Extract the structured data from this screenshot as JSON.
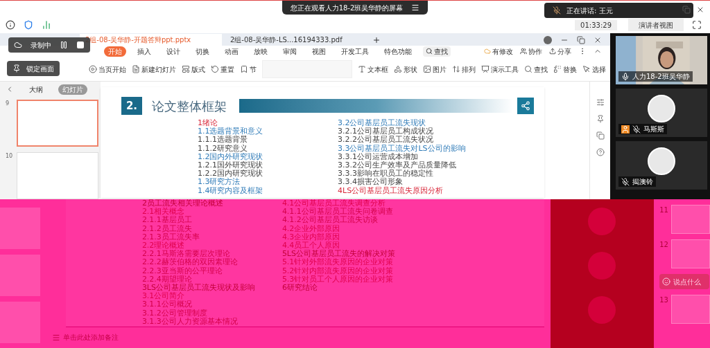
{
  "screen_share_banner": {
    "text": "您正在观看人力18-2班吴华静的屏幕"
  },
  "speaking_toast": {
    "text": "正在讲话: 王元"
  },
  "meeting_bar": {
    "timer": "01:33:29",
    "view_button": "演讲者视图"
  },
  "recording": {
    "status": "录制中",
    "lock_button": "锁定画面"
  },
  "tabs": [
    {
      "label": "2组-08-吴华静-开题答辩ppt.pptx",
      "selected": true
    },
    {
      "label": "2组-08-吴华静-LS...16194333.pdf",
      "selected": false
    }
  ],
  "ribbon_tabs": [
    {
      "label": "开始",
      "selected": true
    },
    {
      "label": "插入",
      "selected": false
    },
    {
      "label": "设计",
      "selected": false
    },
    {
      "label": "切换",
      "selected": false
    },
    {
      "label": "动画",
      "selected": false
    },
    {
      "label": "放映",
      "selected": false
    },
    {
      "label": "审阅",
      "selected": false
    },
    {
      "label": "视图",
      "selected": false
    },
    {
      "label": "开发工具",
      "selected": false
    },
    {
      "label": "特色功能",
      "selected": false
    }
  ],
  "ribbon_search": "查找",
  "ribbon_actions": [
    "有修改",
    "协作",
    "分享"
  ],
  "toolbar": [
    "当页开始",
    "新建幻灯片",
    "版式",
    "重置",
    "节",
    "文本框",
    "形状",
    "图片",
    "排列",
    "演示工具",
    "查找",
    "替换",
    "选择"
  ],
  "pane_tabs": [
    {
      "label": "大纲",
      "selected": false
    },
    {
      "label": "幻灯片",
      "selected": true
    }
  ],
  "thumbnails": [
    {
      "number": "9",
      "selected": true
    },
    {
      "number": "10",
      "selected": false
    }
  ],
  "slide": {
    "number": "2.",
    "title": "论文整体框架",
    "upper_left": [
      {
        "text": "1绪论",
        "kind": "h1"
      },
      {
        "text": "1.1选题背景和意义",
        "kind": "h2"
      },
      {
        "text": "1.1.1选题背景",
        "kind": "h3"
      },
      {
        "text": "1.1.2研究意义",
        "kind": "h3"
      },
      {
        "text": "1.2国内外研究现状",
        "kind": "h2"
      },
      {
        "text": "1.2.1国外研究现状",
        "kind": "h3"
      },
      {
        "text": "1.2.2国内研究现状",
        "kind": "h3"
      },
      {
        "text": "1.3研究方法",
        "kind": "h2"
      },
      {
        "text": "1.4研究内容及框架",
        "kind": "h2"
      }
    ],
    "upper_right": [
      {
        "text": "3.2公司基层员工流失现状",
        "kind": "h2"
      },
      {
        "text": "3.2.1公司基层员工构成状况",
        "kind": "h3"
      },
      {
        "text": "3.2.2公司基层员工流失状况",
        "kind": "h3"
      },
      {
        "text": "3.3公司基层员工流失对LS公司的影响",
        "kind": "h2"
      },
      {
        "text": "3.3.1公司运营成本增加",
        "kind": "h3"
      },
      {
        "text": "3.3.2公司生产效率及产品质量降低",
        "kind": "h3"
      },
      {
        "text": "3.3.3影响在职员工的稳定性",
        "kind": "h3"
      },
      {
        "text": "3.3.4损害公司形象",
        "kind": "h3"
      },
      {
        "text": "4LS公司基层员工流失原因分析",
        "kind": "h1"
      }
    ],
    "lower_left": [
      {
        "text": "2员工流失相关理论概述",
        "kind": "h1"
      },
      {
        "text": "2.1相关概念",
        "kind": "h2"
      },
      {
        "text": "2.1.1基层员工",
        "kind": "h3"
      },
      {
        "text": "2.1.2员工流失",
        "kind": "h3"
      },
      {
        "text": "2.1.3员工流失率",
        "kind": "h3"
      },
      {
        "text": "2.2理论概述",
        "kind": "h2"
      },
      {
        "text": "2.2.1马斯洛需要层次理论",
        "kind": "h3"
      },
      {
        "text": "2.2.2赫茨伯格的双因素理论",
        "kind": "h3"
      },
      {
        "text": "2.2.3亚当斯的公平理论",
        "kind": "h3"
      },
      {
        "text": "2.2.4期望理论",
        "kind": "h3"
      },
      {
        "text": "3LS公司基层员工流失现状及影响",
        "kind": "h1"
      },
      {
        "text": "3.1公司简介",
        "kind": "h2"
      },
      {
        "text": "3.1.1公司概况",
        "kind": "h3"
      },
      {
        "text": "3.1.2公司管理制度",
        "kind": "h3"
      },
      {
        "text": "3.1.3公司人力资源基本情况",
        "kind": "h3"
      }
    ],
    "lower_right": [
      {
        "text": "4.1公司基层员工流失调查分析",
        "kind": "h2"
      },
      {
        "text": "4.1.1公司基层员工流失问卷调查",
        "kind": "h3"
      },
      {
        "text": "4.1.2公司基层员工流失访谈",
        "kind": "h3"
      },
      {
        "text": "4.2企业外部原因",
        "kind": "h2"
      },
      {
        "text": "4.3企业内部原因",
        "kind": "h2"
      },
      {
        "text": "4.4员工个人原因",
        "kind": "h2"
      },
      {
        "text": "5LS公司基层员工流失的解决对策",
        "kind": "h1"
      },
      {
        "text": "5.1针对外部流失原因的企业对策",
        "kind": "h2"
      },
      {
        "text": "5.2针对内部流失原因的企业对策",
        "kind": "h2"
      },
      {
        "text": "5.3针对员工个人原因的企业对策",
        "kind": "h2"
      },
      {
        "text": "6研究结论",
        "kind": "h1"
      }
    ]
  },
  "notes_placeholder": "单击此处添加备注",
  "lower_thumbnails": [
    "11",
    "12",
    "13"
  ],
  "participants": [
    {
      "name": "人力18-2班吴华静",
      "kind": "video",
      "mic_muted": false
    },
    {
      "name": "马斯斯",
      "kind": "avatar",
      "mic_muted": true
    },
    {
      "name": "揭澳铃",
      "kind": "avatar",
      "mic_muted": true
    }
  ],
  "chat": {
    "placeholder": "说点什么"
  }
}
